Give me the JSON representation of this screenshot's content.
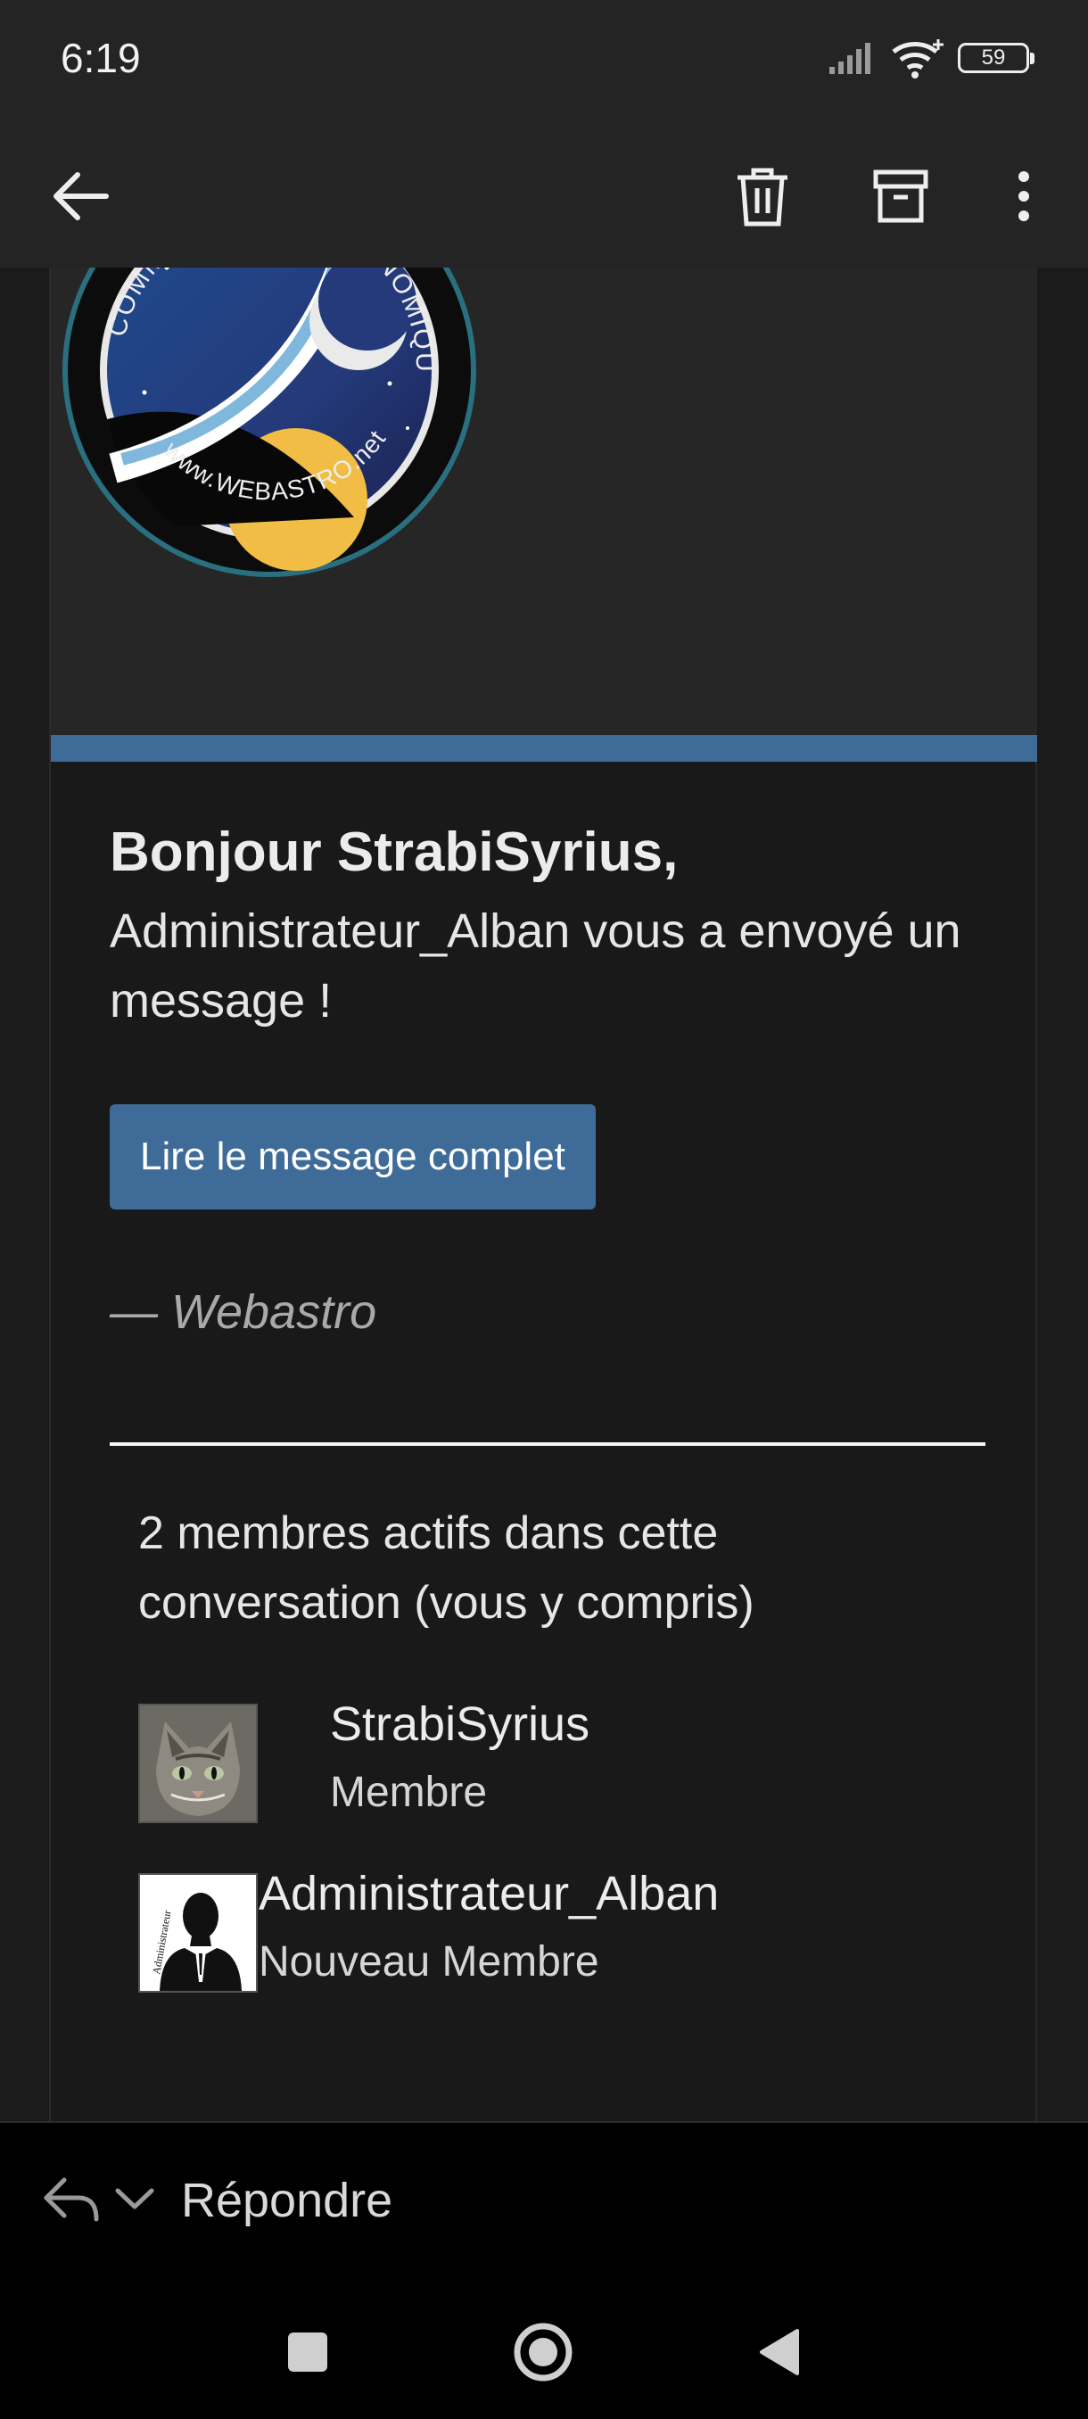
{
  "status_bar": {
    "time": "6:19",
    "battery": "59"
  },
  "toolbar": {
    "back_icon": "arrow-left-icon",
    "delete_icon": "trash-icon",
    "archive_icon": "archive-icon",
    "more_icon": "more-vertical-icon"
  },
  "email": {
    "logo": {
      "top_text": "COMMUNAUTÉ ASTRONOMIQUE",
      "bottom_text": "www.WEBASTRO.net"
    },
    "greeting": "Bonjour StrabiSyrius,",
    "intro": "Administrateur_Alban vous a envoyé un message !",
    "cta_label": "Lire le message complet",
    "signature": "— Webastro",
    "members_title": "2 membres actifs dans cette conversation (vous y compris)",
    "members": [
      {
        "name": "StrabiSyrius",
        "role": "Membre"
      },
      {
        "name": "Administrateur_Alban",
        "role": "Nouveau Membre",
        "avatar_text": "Administrateur"
      }
    ]
  },
  "reply_bar": {
    "label": "Répondre"
  },
  "colors": {
    "accent": "#3f6b98",
    "background": "#191919"
  }
}
